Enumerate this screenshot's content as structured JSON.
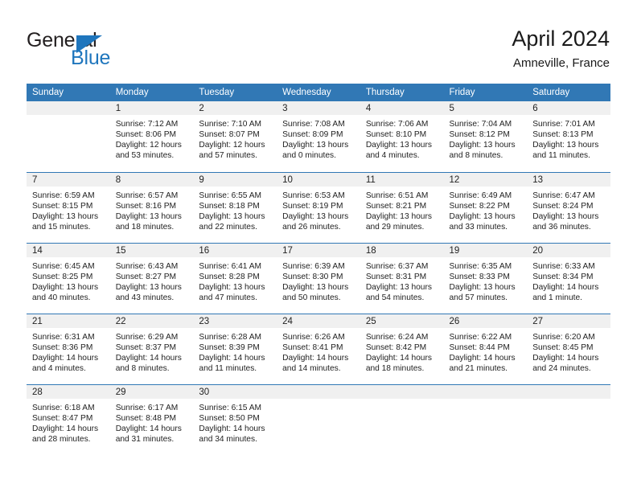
{
  "logo": {
    "word_top": "General",
    "word_bottom": "Blue",
    "triangle_icon": "triangle-icon",
    "accent_color": "#1f76bd"
  },
  "header": {
    "title": "April 2024",
    "subtitle": "Amneville, France"
  },
  "theme": {
    "header_row_bg": "#3178b5",
    "day_band_bg": "#f0f0f0",
    "cell_bg": "#ffffff",
    "text": "#222222"
  },
  "calendar": {
    "weekday_headers": [
      "Sunday",
      "Monday",
      "Tuesday",
      "Wednesday",
      "Thursday",
      "Friday",
      "Saturday"
    ],
    "labels": {
      "sunrise": "Sunrise:",
      "sunset": "Sunset:",
      "daylight": "Daylight:"
    },
    "weeks": [
      [
        {
          "day": "",
          "sunrise": "",
          "sunset": "",
          "daylight_line1": "",
          "daylight_line2": ""
        },
        {
          "day": "1",
          "sunrise": "Sunrise: 7:12 AM",
          "sunset": "Sunset: 8:06 PM",
          "daylight_line1": "Daylight: 12 hours",
          "daylight_line2": "and 53 minutes."
        },
        {
          "day": "2",
          "sunrise": "Sunrise: 7:10 AM",
          "sunset": "Sunset: 8:07 PM",
          "daylight_line1": "Daylight: 12 hours",
          "daylight_line2": "and 57 minutes."
        },
        {
          "day": "3",
          "sunrise": "Sunrise: 7:08 AM",
          "sunset": "Sunset: 8:09 PM",
          "daylight_line1": "Daylight: 13 hours",
          "daylight_line2": "and 0 minutes."
        },
        {
          "day": "4",
          "sunrise": "Sunrise: 7:06 AM",
          "sunset": "Sunset: 8:10 PM",
          "daylight_line1": "Daylight: 13 hours",
          "daylight_line2": "and 4 minutes."
        },
        {
          "day": "5",
          "sunrise": "Sunrise: 7:04 AM",
          "sunset": "Sunset: 8:12 PM",
          "daylight_line1": "Daylight: 13 hours",
          "daylight_line2": "and 8 minutes."
        },
        {
          "day": "6",
          "sunrise": "Sunrise: 7:01 AM",
          "sunset": "Sunset: 8:13 PM",
          "daylight_line1": "Daylight: 13 hours",
          "daylight_line2": "and 11 minutes."
        }
      ],
      [
        {
          "day": "7",
          "sunrise": "Sunrise: 6:59 AM",
          "sunset": "Sunset: 8:15 PM",
          "daylight_line1": "Daylight: 13 hours",
          "daylight_line2": "and 15 minutes."
        },
        {
          "day": "8",
          "sunrise": "Sunrise: 6:57 AM",
          "sunset": "Sunset: 8:16 PM",
          "daylight_line1": "Daylight: 13 hours",
          "daylight_line2": "and 18 minutes."
        },
        {
          "day": "9",
          "sunrise": "Sunrise: 6:55 AM",
          "sunset": "Sunset: 8:18 PM",
          "daylight_line1": "Daylight: 13 hours",
          "daylight_line2": "and 22 minutes."
        },
        {
          "day": "10",
          "sunrise": "Sunrise: 6:53 AM",
          "sunset": "Sunset: 8:19 PM",
          "daylight_line1": "Daylight: 13 hours",
          "daylight_line2": "and 26 minutes."
        },
        {
          "day": "11",
          "sunrise": "Sunrise: 6:51 AM",
          "sunset": "Sunset: 8:21 PM",
          "daylight_line1": "Daylight: 13 hours",
          "daylight_line2": "and 29 minutes."
        },
        {
          "day": "12",
          "sunrise": "Sunrise: 6:49 AM",
          "sunset": "Sunset: 8:22 PM",
          "daylight_line1": "Daylight: 13 hours",
          "daylight_line2": "and 33 minutes."
        },
        {
          "day": "13",
          "sunrise": "Sunrise: 6:47 AM",
          "sunset": "Sunset: 8:24 PM",
          "daylight_line1": "Daylight: 13 hours",
          "daylight_line2": "and 36 minutes."
        }
      ],
      [
        {
          "day": "14",
          "sunrise": "Sunrise: 6:45 AM",
          "sunset": "Sunset: 8:25 PM",
          "daylight_line1": "Daylight: 13 hours",
          "daylight_line2": "and 40 minutes."
        },
        {
          "day": "15",
          "sunrise": "Sunrise: 6:43 AM",
          "sunset": "Sunset: 8:27 PM",
          "daylight_line1": "Daylight: 13 hours",
          "daylight_line2": "and 43 minutes."
        },
        {
          "day": "16",
          "sunrise": "Sunrise: 6:41 AM",
          "sunset": "Sunset: 8:28 PM",
          "daylight_line1": "Daylight: 13 hours",
          "daylight_line2": "and 47 minutes."
        },
        {
          "day": "17",
          "sunrise": "Sunrise: 6:39 AM",
          "sunset": "Sunset: 8:30 PM",
          "daylight_line1": "Daylight: 13 hours",
          "daylight_line2": "and 50 minutes."
        },
        {
          "day": "18",
          "sunrise": "Sunrise: 6:37 AM",
          "sunset": "Sunset: 8:31 PM",
          "daylight_line1": "Daylight: 13 hours",
          "daylight_line2": "and 54 minutes."
        },
        {
          "day": "19",
          "sunrise": "Sunrise: 6:35 AM",
          "sunset": "Sunset: 8:33 PM",
          "daylight_line1": "Daylight: 13 hours",
          "daylight_line2": "and 57 minutes."
        },
        {
          "day": "20",
          "sunrise": "Sunrise: 6:33 AM",
          "sunset": "Sunset: 8:34 PM",
          "daylight_line1": "Daylight: 14 hours",
          "daylight_line2": "and 1 minute."
        }
      ],
      [
        {
          "day": "21",
          "sunrise": "Sunrise: 6:31 AM",
          "sunset": "Sunset: 8:36 PM",
          "daylight_line1": "Daylight: 14 hours",
          "daylight_line2": "and 4 minutes."
        },
        {
          "day": "22",
          "sunrise": "Sunrise: 6:29 AM",
          "sunset": "Sunset: 8:37 PM",
          "daylight_line1": "Daylight: 14 hours",
          "daylight_line2": "and 8 minutes."
        },
        {
          "day": "23",
          "sunrise": "Sunrise: 6:28 AM",
          "sunset": "Sunset: 8:39 PM",
          "daylight_line1": "Daylight: 14 hours",
          "daylight_line2": "and 11 minutes."
        },
        {
          "day": "24",
          "sunrise": "Sunrise: 6:26 AM",
          "sunset": "Sunset: 8:41 PM",
          "daylight_line1": "Daylight: 14 hours",
          "daylight_line2": "and 14 minutes."
        },
        {
          "day": "25",
          "sunrise": "Sunrise: 6:24 AM",
          "sunset": "Sunset: 8:42 PM",
          "daylight_line1": "Daylight: 14 hours",
          "daylight_line2": "and 18 minutes."
        },
        {
          "day": "26",
          "sunrise": "Sunrise: 6:22 AM",
          "sunset": "Sunset: 8:44 PM",
          "daylight_line1": "Daylight: 14 hours",
          "daylight_line2": "and 21 minutes."
        },
        {
          "day": "27",
          "sunrise": "Sunrise: 6:20 AM",
          "sunset": "Sunset: 8:45 PM",
          "daylight_line1": "Daylight: 14 hours",
          "daylight_line2": "and 24 minutes."
        }
      ],
      [
        {
          "day": "28",
          "sunrise": "Sunrise: 6:18 AM",
          "sunset": "Sunset: 8:47 PM",
          "daylight_line1": "Daylight: 14 hours",
          "daylight_line2": "and 28 minutes."
        },
        {
          "day": "29",
          "sunrise": "Sunrise: 6:17 AM",
          "sunset": "Sunset: 8:48 PM",
          "daylight_line1": "Daylight: 14 hours",
          "daylight_line2": "and 31 minutes."
        },
        {
          "day": "30",
          "sunrise": "Sunrise: 6:15 AM",
          "sunset": "Sunset: 8:50 PM",
          "daylight_line1": "Daylight: 14 hours",
          "daylight_line2": "and 34 minutes."
        },
        {
          "day": "",
          "sunrise": "",
          "sunset": "",
          "daylight_line1": "",
          "daylight_line2": ""
        },
        {
          "day": "",
          "sunrise": "",
          "sunset": "",
          "daylight_line1": "",
          "daylight_line2": ""
        },
        {
          "day": "",
          "sunrise": "",
          "sunset": "",
          "daylight_line1": "",
          "daylight_line2": ""
        },
        {
          "day": "",
          "sunrise": "",
          "sunset": "",
          "daylight_line1": "",
          "daylight_line2": ""
        }
      ]
    ]
  }
}
